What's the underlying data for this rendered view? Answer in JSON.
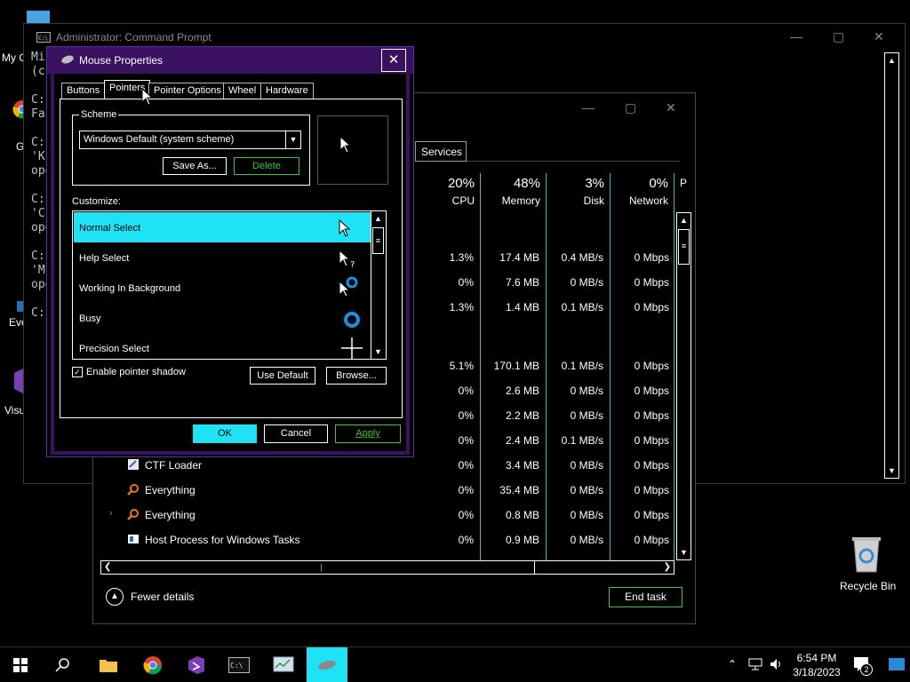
{
  "desktop": {
    "icons": [
      {
        "label": "My C",
        "name": "my-computer"
      },
      {
        "label": "G",
        "name": "chrome"
      },
      {
        "label": "Eve",
        "name": "everything"
      },
      {
        "label": "Visu",
        "name": "visual-studio"
      },
      {
        "label": "Recycle Bin",
        "name": "recycle-bin"
      }
    ]
  },
  "cmd": {
    "title": "Administrator: Command Prompt",
    "lines": [
      "Mi",
      "(c",
      "",
      "C:",
      "Fa",
      "",
      "C:",
      "'K'",
      "ope",
      "",
      "C:",
      "'C",
      "ope",
      "",
      "C:",
      "'M",
      "ope",
      "",
      "C:"
    ]
  },
  "taskmgr": {
    "tab_services": "Services",
    "columns": [
      {
        "pct": "20%",
        "name": "CPU"
      },
      {
        "pct": "48%",
        "name": "Memory"
      },
      {
        "pct": "3%",
        "name": "Disk"
      },
      {
        "pct": "0%",
        "name": "Network"
      },
      {
        "pct": "",
        "name": "P"
      }
    ],
    "rows": [
      {
        "name": "",
        "cpu": "1.3%",
        "mem": "17.4 MB",
        "disk": "0.4 MB/s",
        "net": "0 Mbps"
      },
      {
        "name": "",
        "cpu": "0%",
        "mem": "7.6 MB",
        "disk": "0 MB/s",
        "net": "0 Mbps"
      },
      {
        "name": "",
        "cpu": "1.3%",
        "mem": "1.4 MB",
        "disk": "0.1 MB/s",
        "net": "0 Mbps"
      },
      {
        "name": "",
        "cpu": "5.1%",
        "mem": "170.1 MB",
        "disk": "0.1 MB/s",
        "net": "0 Mbps"
      },
      {
        "name": "",
        "cpu": "0%",
        "mem": "2.6 MB",
        "disk": "0 MB/s",
        "net": "0 Mbps"
      },
      {
        "name": "",
        "cpu": "0%",
        "mem": "2.2 MB",
        "disk": "0 MB/s",
        "net": "0 Mbps"
      },
      {
        "name": "",
        "cpu": "0%",
        "mem": "2.4 MB",
        "disk": "0.1 MB/s",
        "net": "0 Mbps"
      },
      {
        "name": "CTF Loader",
        "cpu": "0%",
        "mem": "3.4 MB",
        "disk": "0 MB/s",
        "net": "0 Mbps"
      },
      {
        "name": "Everything",
        "cpu": "0%",
        "mem": "35.4 MB",
        "disk": "0 MB/s",
        "net": "0 Mbps"
      },
      {
        "name": "Everything",
        "cpu": "0%",
        "mem": "0.8 MB",
        "disk": "0 MB/s",
        "net": "0 Mbps"
      },
      {
        "name": "Host Process for Windows Tasks",
        "cpu": "0%",
        "mem": "0.9 MB",
        "disk": "0 MB/s",
        "net": "0 Mbps"
      }
    ],
    "fewer_details": "Fewer details",
    "end_task": "End task"
  },
  "mouse": {
    "title": "Mouse Properties",
    "tabs": [
      "Buttons",
      "Pointers",
      "Pointer Options",
      "Wheel",
      "Hardware"
    ],
    "active_tab": "Pointers",
    "scheme_label": "Scheme",
    "scheme_value": "Windows Default (system scheme)",
    "save_as": "Save As...",
    "delete": "Delete",
    "customize_label": "Customize:",
    "pointers": [
      "Normal Select",
      "Help Select",
      "Working In Background",
      "Busy",
      "Precision Select"
    ],
    "selected_pointer": "Normal Select",
    "shadow_label": "Enable pointer shadow",
    "shadow_checked": true,
    "use_default": "Use Default",
    "browse": "Browse...",
    "ok": "OK",
    "cancel": "Cancel",
    "apply": "Apply"
  },
  "taskbar": {
    "time": "6:54 PM",
    "date": "3/18/2023",
    "notification_count": "2"
  },
  "colors": {
    "accent_cyan": "#1fe3f5",
    "accent_green": "#3dc23d",
    "title_purple": "#3a1060"
  }
}
